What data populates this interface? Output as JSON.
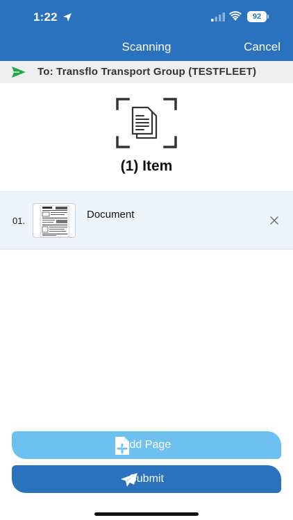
{
  "status_bar": {
    "time": "1:22",
    "battery": "92",
    "icons": [
      "location-arrow-icon",
      "cellular-signal-icon",
      "wifi-icon",
      "battery-icon"
    ]
  },
  "header": {
    "title": "Scanning",
    "cancel_label": "Cancel",
    "color": "#2a72bd"
  },
  "recipient": {
    "text": "To: Transflo Transport Group (TESTFLEET)",
    "icon": "paper-plane-icon",
    "icon_color": "#1fa84a"
  },
  "summary": {
    "icon": "document-scan-icon",
    "count_label": "(1) Item"
  },
  "documents": [
    {
      "index": "01.",
      "name": "Document",
      "thumbnail": "document-thumbnail",
      "remove_icon": "close-icon"
    }
  ],
  "actions": {
    "add_page_label": "Add Page",
    "add_page_icon": "file-plus-icon",
    "add_page_color": "#6ec0ee",
    "submit_label": "Submit",
    "submit_icon": "paper-plane-icon",
    "submit_color": "#2a72bd"
  }
}
